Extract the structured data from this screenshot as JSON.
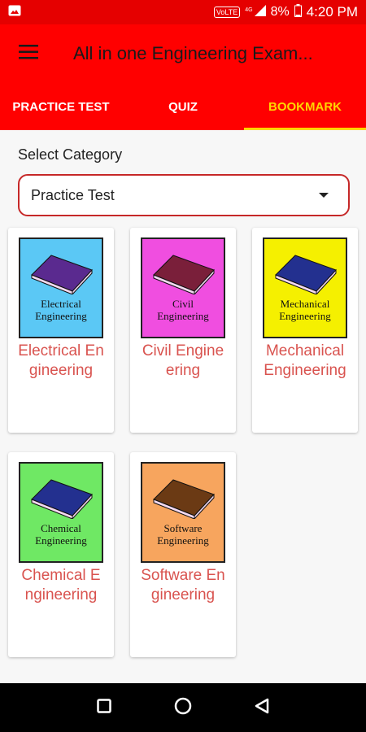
{
  "status_bar": {
    "volte": "VoLTE",
    "network": "4G",
    "battery": "8%",
    "time": "4:20 PM"
  },
  "app_bar": {
    "title": "All in one Engineering Exam..."
  },
  "tabs": [
    {
      "label": "PRACTICE TEST",
      "active": false
    },
    {
      "label": "QUIZ",
      "active": false
    },
    {
      "label": "BOOKMARK",
      "active": true
    }
  ],
  "category": {
    "label": "Select Category",
    "selected": "Practice Test"
  },
  "cards": [
    {
      "title": "Electrical Engineering",
      "thumb_line1": "Electrical",
      "thumb_line2": "Engineering",
      "bg": "#5bc8f5",
      "book": "#5a2a8f"
    },
    {
      "title": "Civil Engineering",
      "thumb_line1": "Civil",
      "thumb_line2": "Engineering",
      "bg": "#f04ee0",
      "book": "#7a1f3a"
    },
    {
      "title": "Mechanical Engineering",
      "thumb_line1": "Mechanical",
      "thumb_line2": "Engineering",
      "bg": "#f5f000",
      "book": "#23308f"
    },
    {
      "title": "Chemical Engineering",
      "thumb_line1": "Chemical",
      "thumb_line2": "Engineering",
      "bg": "#6fe864",
      "book": "#23308f"
    },
    {
      "title": "Software Engineering",
      "thumb_line1": "Software",
      "thumb_line2": "Engineering",
      "bg": "#f7a55e",
      "book": "#6b3a14"
    }
  ],
  "icons": {
    "menu": "hamburger-menu-icon",
    "recents": "square-icon",
    "home": "circle-icon",
    "back": "triangle-back-icon"
  },
  "colors": {
    "primary": "#ff0000",
    "status_bar": "#e50000",
    "tab_active": "#ffd600",
    "card_title": "#d9534f"
  }
}
